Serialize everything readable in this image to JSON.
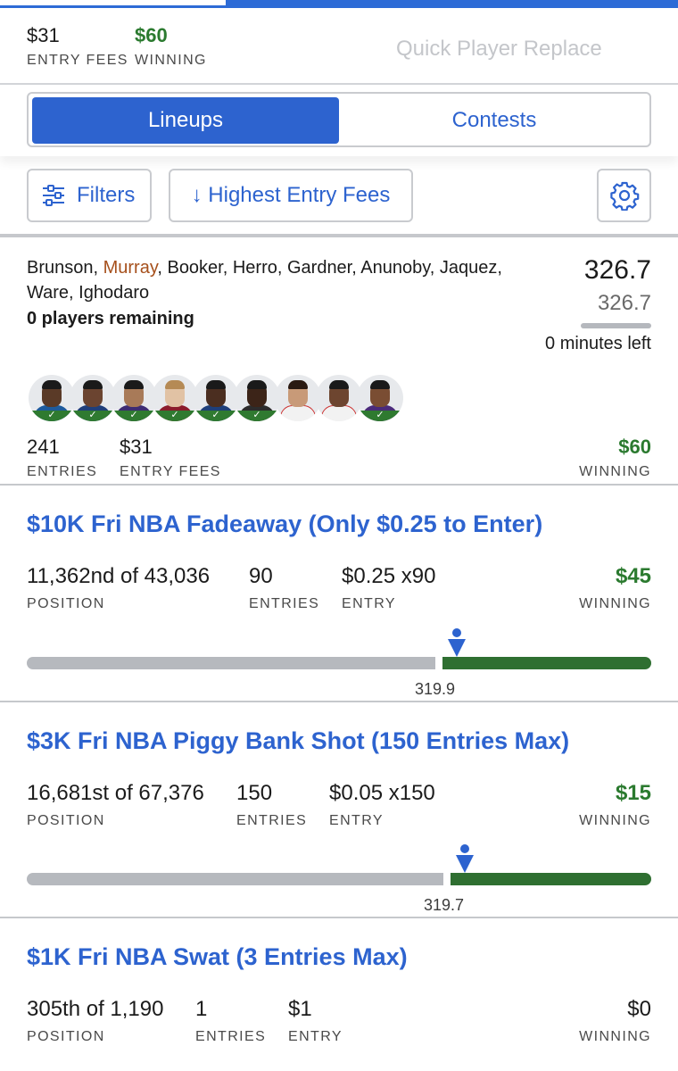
{
  "summary": {
    "entry_fees_value": "$31",
    "entry_fees_label": "ENTRY FEES",
    "winning_value": "$60",
    "winning_label": "WINNING",
    "quick_replace": "Quick Player Replace"
  },
  "tabs": {
    "lineups": "Lineups",
    "contests": "Contests",
    "active": "Lineups"
  },
  "toolbar": {
    "filters_label": "Filters",
    "sort_label": "↓ Highest Entry Fees",
    "icons": {
      "filters": "sliders-icon",
      "settings": "gear-icon"
    }
  },
  "lineup": {
    "names_before": "Brunson, ",
    "names_highlight": "Murray",
    "names_after": ", Booker, Herro, Gardner, Anunoby, Jaquez, Ware, Ighodaro",
    "remaining": "0 players remaining",
    "score": "326.7",
    "projected": "326.7",
    "time_left": "0 minutes left",
    "entries_value": "241",
    "entries_label": "ENTRIES",
    "entry_fees_value": "$31",
    "entry_fees_label": "ENTRY FEES",
    "winning_value": "$60",
    "winning_label": "WINNING",
    "accent_colors": {
      "highlight_name": "#a6501c",
      "winning": "#2b7a2f",
      "brand": "#2d63cf"
    }
  },
  "contests": [
    {
      "title": "$10K Fri NBA Fadeaway (Only $0.25 to Enter)",
      "position_value": "11,362nd of 43,036",
      "position_label": "POSITION",
      "entries_value": "90",
      "entries_label": "ENTRIES",
      "entry_value": "$0.25 x90",
      "entry_label": "ENTRY",
      "winning_value": "$45",
      "winning_label": "WINNING",
      "marker_value": "319.9",
      "marker_fraction": 0.66
    },
    {
      "title": "$3K Fri NBA Piggy Bank Shot (150 Entries Max)",
      "position_value": "16,681st of 67,376",
      "position_label": "POSITION",
      "entries_value": "150",
      "entries_label": "ENTRIES",
      "entry_value": "$0.05 x150",
      "entry_label": "ENTRY",
      "winning_value": "$15",
      "winning_label": "WINNING",
      "marker_value": "319.7",
      "marker_fraction": 0.675
    },
    {
      "title": "$1K Fri NBA Swat (3 Entries Max)",
      "position_value": "305th of 1,190",
      "position_label": "POSITION",
      "entries_value": "1",
      "entries_label": "ENTRIES",
      "entry_value": "$1",
      "entry_label": "ENTRY",
      "winning_value": "$0",
      "winning_label": "WINNING"
    }
  ]
}
